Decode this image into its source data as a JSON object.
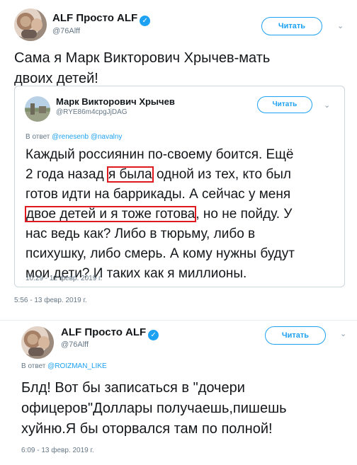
{
  "tweet1": {
    "author_name": "ALF Просто ALF",
    "author_handle": "@76Alff",
    "follow_label": "Читать",
    "text_lines": [
      "Сама я Марк Викторович Хрычев-мать",
      "двоих детей!"
    ],
    "quoted": {
      "author_name": "Марк Викторович Хрычев",
      "author_handle": "@RYE86m4cpgJjDAG",
      "follow_label": "Читать",
      "reply_prefix": "В ответ",
      "mentions": [
        "@renesenb",
        "@navalny"
      ],
      "text": {
        "l1": "Каждый россиянин по-своему боится. Ещё",
        "l2_pre": "2 года назад",
        "l2_hl": "я была",
        "l2_post": "одной из тех, кто был",
        "l3": "готов идти на баррикады. А сейчас у меня",
        "l4_hl": "двое детей и я тоже готова",
        "l4_post": ", но не пойду. У",
        "l5": "нас ведь как? Либо в тюрьму, либо в",
        "l6": "психушку, либо смерь. А кому нужны будут",
        "l7": "мои дети? И таких как я миллионы."
      },
      "timestamp": "10:29 - 12 февр. 2019 г."
    },
    "timestamp": "5:56 - 13 февр. 2019 г."
  },
  "tweet2": {
    "author_name": "ALF Просто ALF",
    "author_handle": "@76Alff",
    "follow_label": "Читать",
    "reply_prefix": "В ответ",
    "mention": "@ROIZMAN_LIKE",
    "text_lines": [
      "Блд! Вот бы записаться в \"дочери",
      "офицеров\"Доллары получаешь,пишешь",
      "хуйню.Я бы оторвался там по полной!"
    ],
    "timestamp": "6:09 - 13 февр. 2019 г."
  },
  "icons": {
    "verified": "verified-badge-icon",
    "chevron": "chevron-down-icon"
  },
  "colors": {
    "accent": "#1da1f2",
    "highlight": "#e0191f",
    "secondary_text": "#657786"
  }
}
